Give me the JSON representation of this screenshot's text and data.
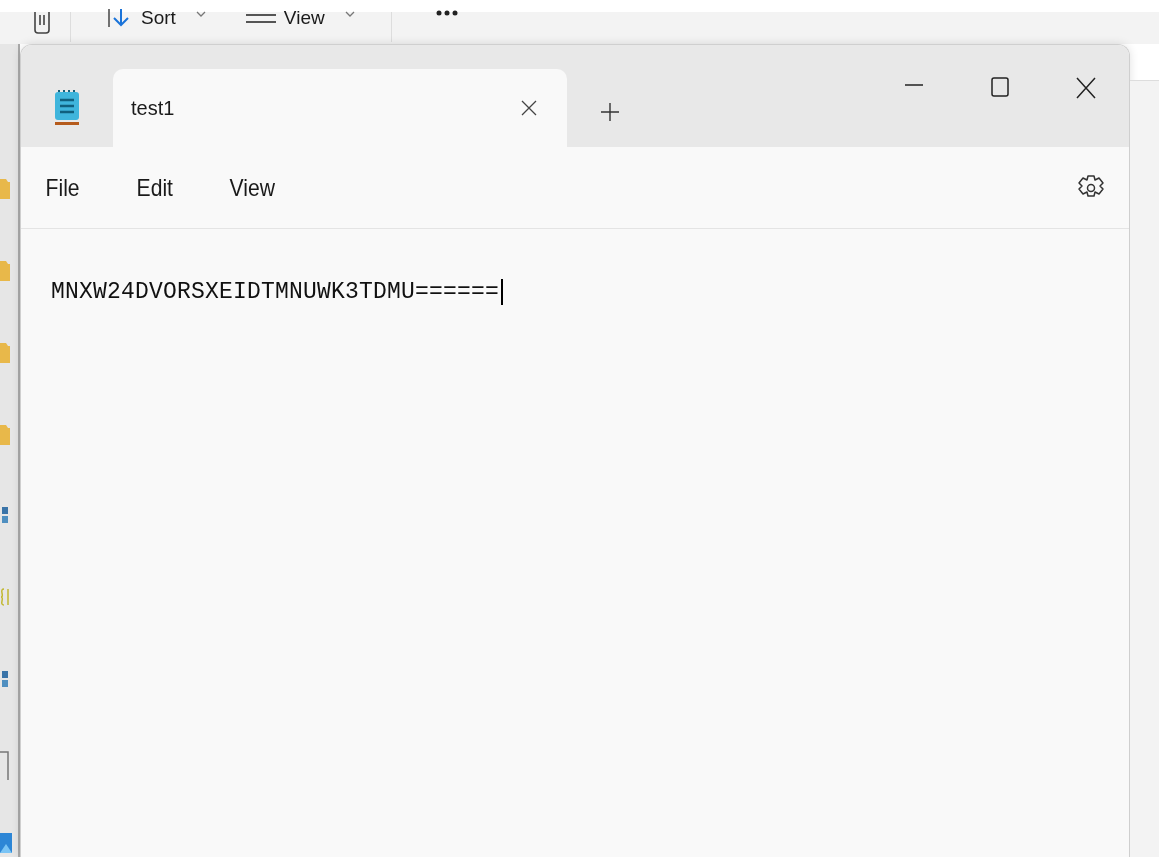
{
  "explorer_toolbar": {
    "buttons": [
      {
        "label": "Sort"
      },
      {
        "label": "View"
      }
    ]
  },
  "explorer_sidebar": {
    "icons": [
      {
        "kind": "folder"
      },
      {
        "kind": "folder"
      },
      {
        "kind": "folder"
      },
      {
        "kind": "folder"
      },
      {
        "kind": "python"
      },
      {
        "kind": "json"
      },
      {
        "kind": "python"
      },
      {
        "kind": "blank"
      },
      {
        "kind": "image"
      }
    ]
  },
  "window": {
    "tabs": [
      {
        "title": "test1",
        "selected": true
      }
    ],
    "menu": [
      "File",
      "Edit",
      "View"
    ],
    "document": {
      "text": "MNXW24DVORSXEIDTMNUWK3TDMU======",
      "caret": true
    }
  }
}
